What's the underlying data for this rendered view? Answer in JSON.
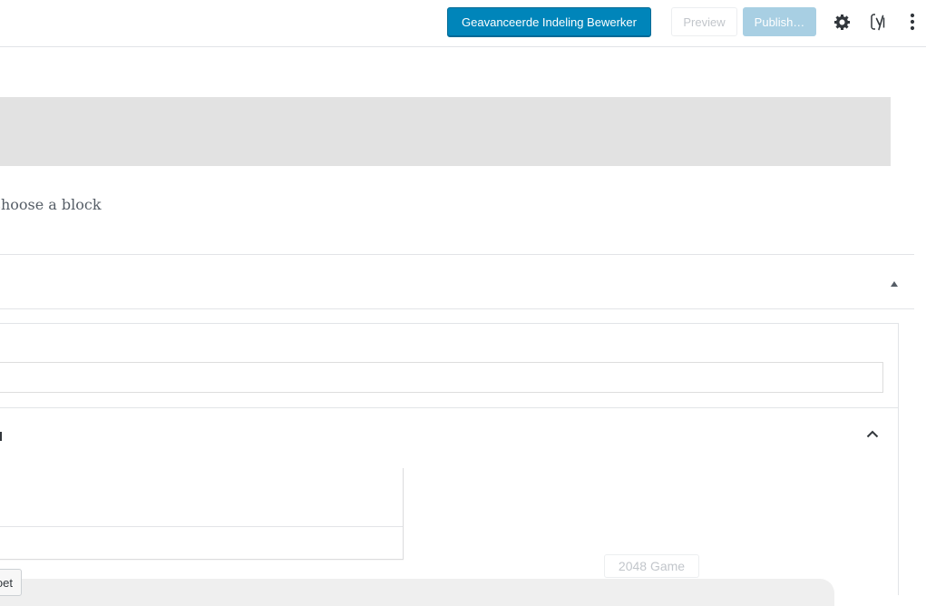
{
  "toolbar": {
    "advanced_editor_label": "Geavanceerde Indeling Bewerker",
    "preview_label": "Preview",
    "publish_label": "Publish…",
    "settings_icon": "gear-icon",
    "yoast_icon": "yoast-icon",
    "more_icon": "more-vertical-icon"
  },
  "editor": {
    "block_prompt": "choose a block"
  },
  "meta_box": {
    "partial_button_label": "oet",
    "tooltip_label": "2048 Game"
  },
  "colors": {
    "primary": "#0085ba",
    "publish_disabled": "#a8cfe3",
    "title_placeholder_bg": "#e2e2e2"
  }
}
